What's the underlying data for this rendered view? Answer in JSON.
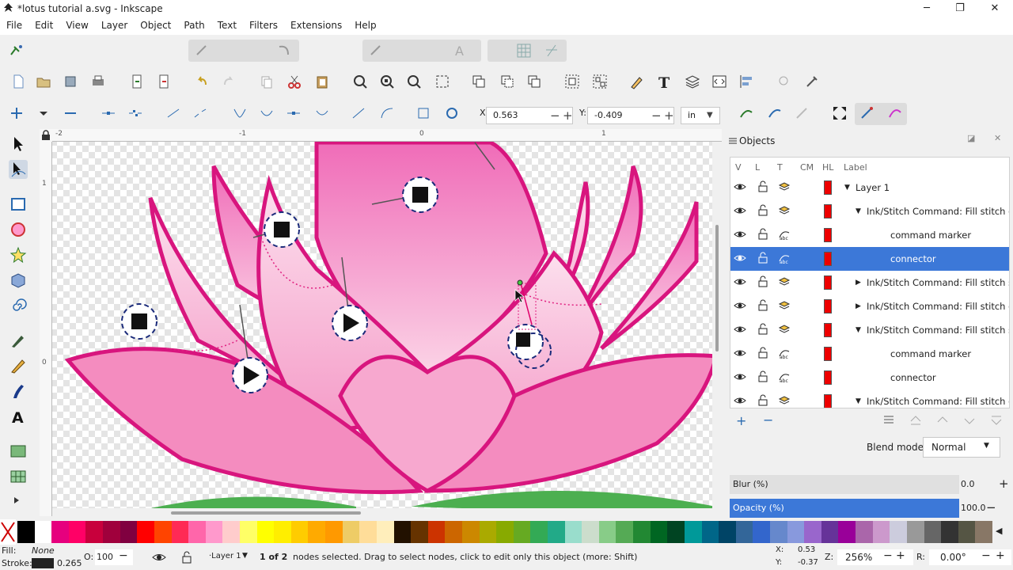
{
  "window": {
    "title": "*lotus tutorial a.svg - Inkscape",
    "minimize": "─",
    "maximize": "❐",
    "close": "✕"
  },
  "menu": [
    "File",
    "Edit",
    "View",
    "Layer",
    "Object",
    "Path",
    "Text",
    "Filters",
    "Extensions",
    "Help"
  ],
  "node_toolbar": {
    "x_label": "X:",
    "x_value": "0.563",
    "y_label": "Y:",
    "y_value": "-0.409",
    "unit": "in"
  },
  "rulers": {
    "top_labels": [
      "-2",
      "-1",
      "0",
      "1"
    ],
    "left_labels": [
      "1",
      "0"
    ]
  },
  "objects_panel": {
    "title": "Objects",
    "columns": [
      "V",
      "L",
      "T",
      "CM",
      "HL",
      "Label"
    ],
    "rows": [
      {
        "label": "Layer 1",
        "indent": 1,
        "arrow": "▼",
        "type": "layer",
        "selected": false
      },
      {
        "label": "Ink/Stitch Command: Fill stitch endi",
        "indent": 2,
        "arrow": "▼",
        "type": "group",
        "selected": false
      },
      {
        "label": "command marker",
        "indent": 3,
        "arrow": "",
        "type": "path",
        "selected": false
      },
      {
        "label": "connector",
        "indent": 3,
        "arrow": "",
        "type": "path",
        "selected": true
      },
      {
        "label": "Ink/Stitch Command: Fill stitch starti",
        "indent": 2,
        "arrow": "▶",
        "type": "group",
        "selected": false
      },
      {
        "label": "Ink/Stitch Command: Fill stitch endi",
        "indent": 2,
        "arrow": "▶",
        "type": "group",
        "selected": false
      },
      {
        "label": "Ink/Stitch Command: Fill stitch starti",
        "indent": 2,
        "arrow": "▼",
        "type": "group",
        "selected": false
      },
      {
        "label": "command marker",
        "indent": 3,
        "arrow": "",
        "type": "path",
        "selected": false
      },
      {
        "label": "connector",
        "indent": 3,
        "arrow": "",
        "type": "path",
        "selected": false
      },
      {
        "label": "Ink/Stitch Command: Fill stitch endi",
        "indent": 2,
        "arrow": "▼",
        "type": "group",
        "selected": false
      }
    ],
    "add_icon": "+",
    "remove_icon": "−",
    "blend_label": "Blend mode:",
    "blend_value": "Normal",
    "blur_label": "Blur (%)",
    "blur_value": "0.0",
    "opacity_label": "Opacity (%)",
    "opacity_value": "100.0",
    "opacity_fraction": 1.0
  },
  "palette": [
    "#000000",
    "#ffffff",
    "#e6007e",
    "#ff0066",
    "#c8003c",
    "#a0003c",
    "#800040",
    "#ff0000",
    "#ff4400",
    "#ff2a55",
    "#ff66aa",
    "#ff99cc",
    "#ffcccc",
    "#ffff66",
    "#ffff00",
    "#ffee00",
    "#ffcc00",
    "#ffaa00",
    "#ff9900",
    "#eecc66",
    "#ffdd99",
    "#ffeebb",
    "#221100",
    "#663300",
    "#cc3300",
    "#cc6600",
    "#cc8800",
    "#aaaa00",
    "#88aa00",
    "#66aa22",
    "#33aa55",
    "#22aa88",
    "#99ddcc",
    "#ccddcc",
    "#88cc88",
    "#55aa55",
    "#228833",
    "#006622",
    "#004422",
    "#009999",
    "#006688",
    "#004466",
    "#336699",
    "#3366cc",
    "#6688cc",
    "#8899dd",
    "#9966cc",
    "#663399",
    "#990099",
    "#aa66aa",
    "#cc99cc",
    "#ccccdd",
    "#999999",
    "#666666",
    "#333333",
    "#555544",
    "#887766"
  ],
  "status": {
    "fill_label": "Fill:",
    "fill_value": "None",
    "stroke_label": "Stroke:",
    "stroke_width": "0.265",
    "opacity_label": "O:",
    "opacity_value": "100",
    "layer_value": "·Layer 1",
    "message_bold": "1 of 2",
    "message": " nodes selected. Drag to select nodes, click to edit only this object (more: Shift)",
    "cursor_x_label": "X:",
    "cursor_x": "0.53",
    "cursor_y_label": "Y:",
    "cursor_y": "-0.37",
    "zoom_label": "Z:",
    "zoom_value": "256%",
    "rotate_label": "R:",
    "rotate_value": "0.00°"
  }
}
